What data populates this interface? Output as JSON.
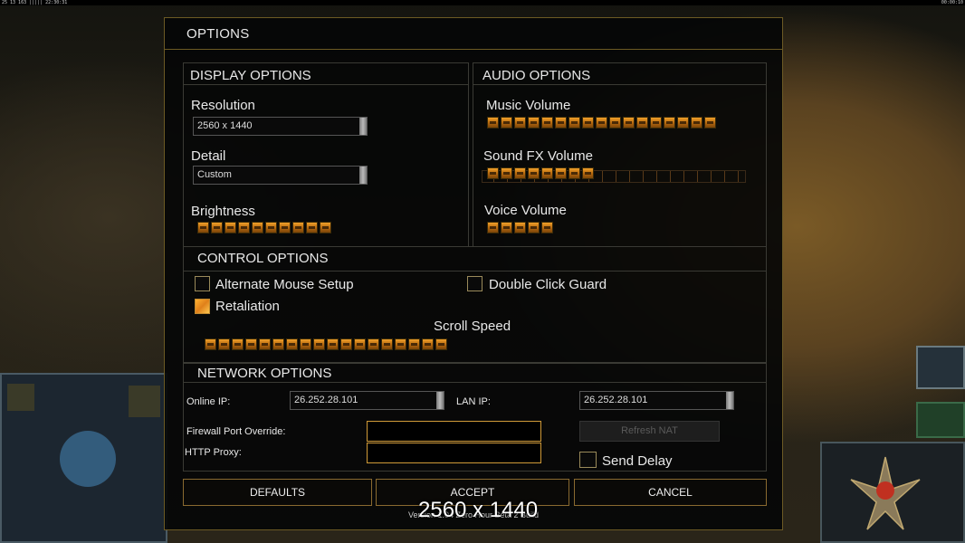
{
  "hud": {
    "top_left": "25 13 163 ||||| 22:30:31",
    "top_right": "00:00:10"
  },
  "dialog": {
    "title": "OPTIONS",
    "display": {
      "heading": "DISPLAY OPTIONS",
      "resolution_label": "Resolution",
      "resolution_value": "2560 x 1440",
      "detail_label": "Detail",
      "detail_value": "Custom",
      "brightness_label": "Brightness",
      "brightness_level": 10
    },
    "audio": {
      "heading": "AUDIO OPTIONS",
      "music_label": "Music Volume",
      "music_level": 17,
      "sfx_label": "Sound FX Volume",
      "sfx_level": 8,
      "voice_label": "Voice Volume",
      "voice_level": 5
    },
    "control": {
      "heading": "CONTROL OPTIONS",
      "alt_mouse_label": "Alternate Mouse Setup",
      "alt_mouse_checked": false,
      "double_click_label": "Double Click Guard",
      "double_click_checked": false,
      "retaliation_label": "Retaliation",
      "retaliation_checked": true,
      "scroll_label": "Scroll Speed",
      "scroll_level": 18
    },
    "network": {
      "heading": "NETWORK OPTIONS",
      "online_ip_label": "Online IP:",
      "online_ip_value": "26.252.28.101",
      "lan_ip_label": "LAN IP:",
      "lan_ip_value": "26.252.28.101",
      "firewall_label": "Firewall Port Override:",
      "firewall_value": "",
      "http_proxy_label": "HTTP Proxy:",
      "http_proxy_value": "",
      "refresh_nat_label": "Refresh NAT",
      "send_delay_label": "Send Delay",
      "send_delay_checked": false
    },
    "buttons": {
      "defaults": "DEFAULTS",
      "accept": "ACCEPT",
      "cancel": "CANCEL"
    },
    "version_text": "Version 1.04 Zero Hour Beta 2 Build"
  },
  "overlay_text": "2560 x 1440"
}
